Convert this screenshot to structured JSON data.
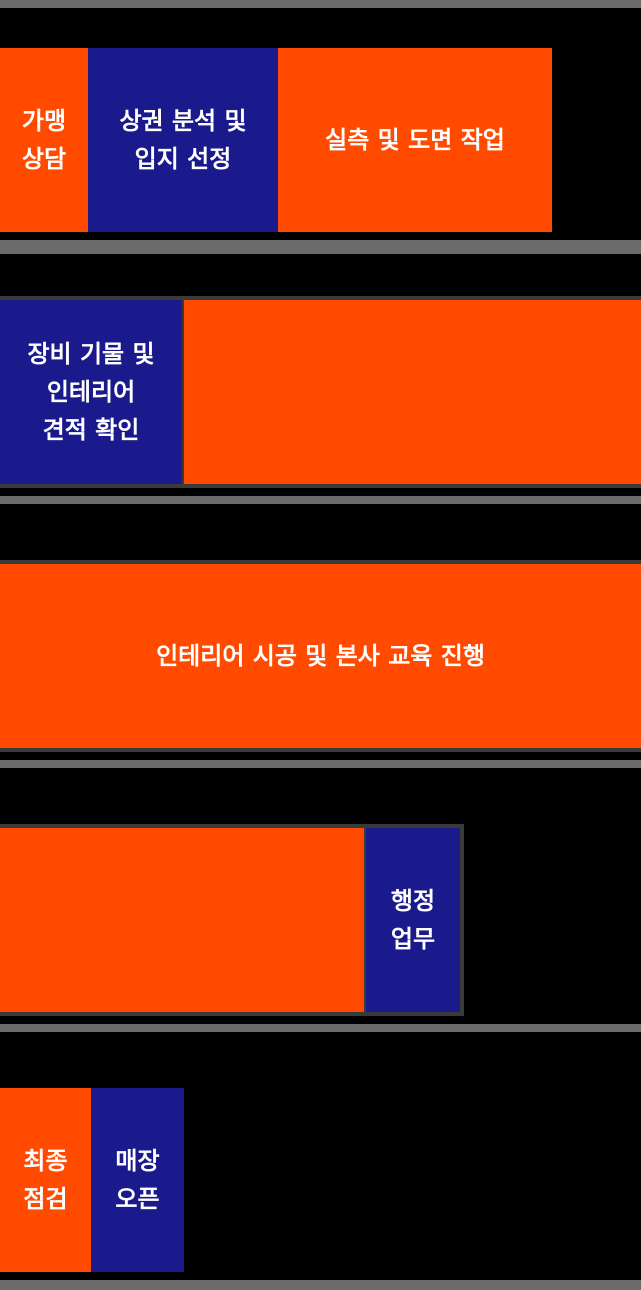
{
  "colors": {
    "background": "#000000",
    "orange": "#ff4a00",
    "navy": "#1a1a8c",
    "divider": "#6b6b6b"
  },
  "steps": {
    "consult": "가맹\n상담",
    "site_analysis": "상권 분석 및\n입지 선정",
    "survey": "실측 및 도면 작업",
    "estimate": "장비 기물 및\n인테리어\n견적 확인",
    "construction": "인테리어 시공 및 본사 교육 진행",
    "admin": "행정\n업무",
    "final_check": "최종\n점검",
    "open": "매장\n오픈"
  }
}
